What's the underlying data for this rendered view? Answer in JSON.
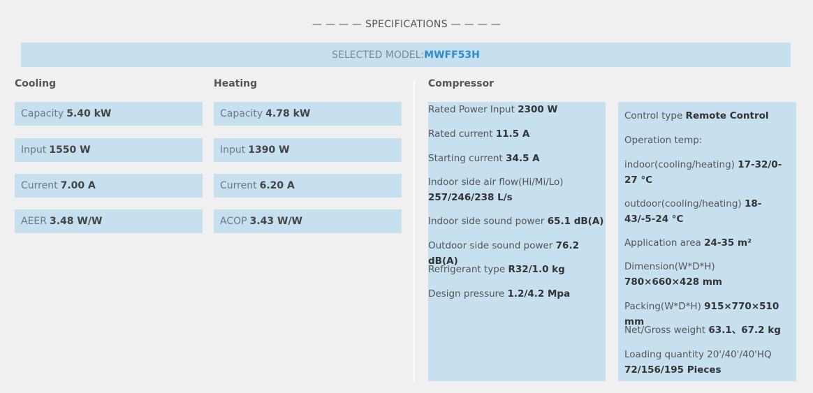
{
  "title": "— — — — SPECIFICATIONS — — — —",
  "selected_label": "SELECTED MODEL:",
  "selected_model": "MWFF53H",
  "cooling": {
    "heading": "Cooling",
    "items": [
      {
        "label": "Capacity",
        "value": "5.40 kW"
      },
      {
        "label": "Input",
        "value": "1550 W"
      },
      {
        "label": "Current",
        "value": "7.00 A"
      },
      {
        "label": "AEER",
        "value": "3.48 W/W"
      }
    ]
  },
  "heating": {
    "heading": "Heating",
    "items": [
      {
        "label": "Capacity",
        "value": "4.78 kW"
      },
      {
        "label": "Input",
        "value": "1390 W"
      },
      {
        "label": "Current",
        "value": "6.20 A"
      },
      {
        "label": "ACOP",
        "value": "3.43 W/W"
      }
    ]
  },
  "compressor": {
    "heading": "Compressor",
    "items": [
      {
        "label": "Rated Power Input",
        "value": "2300 W"
      },
      {
        "label": "Rated current",
        "value": "11.5 A"
      },
      {
        "label": "Starting current",
        "value": "34.5 A"
      },
      {
        "label": "Indoor side air flow(Hi/Mi/Lo)",
        "value": "257/246/238 L/s"
      },
      {
        "label": "Indoor side sound power",
        "value": "65.1 dB(A)"
      },
      {
        "label": "Outdoor side sound power",
        "value": "76.2 dB(A)"
      },
      {
        "label": "Refrigerant type",
        "value": "R32/1.0 kg"
      },
      {
        "label": "Design pressure",
        "value": "1.2/4.2 Mpa"
      }
    ]
  },
  "other": {
    "items": [
      {
        "label": "Control type",
        "value": "Remote Control"
      },
      {
        "label": "Operation temp:",
        "value": ""
      },
      {
        "label": "indoor(cooling/heating)",
        "value": "17-32/0-27 °C"
      },
      {
        "label": "outdoor(cooling/heating)",
        "value": "18-43/-5-24 °C"
      },
      {
        "label": "Application area",
        "value": "24-35 m²"
      },
      {
        "label": "Dimension(W*D*H)",
        "value": "780×660×428 mm"
      },
      {
        "label": "Packing(W*D*H)",
        "value": "915×770×510 mm"
      },
      {
        "label": "Net/Gross weight",
        "value": "63.1、67.2 kg"
      },
      {
        "label": "Loading quantity 20'/40'/40'HQ",
        "value": "72/156/195 Pieces"
      }
    ]
  }
}
